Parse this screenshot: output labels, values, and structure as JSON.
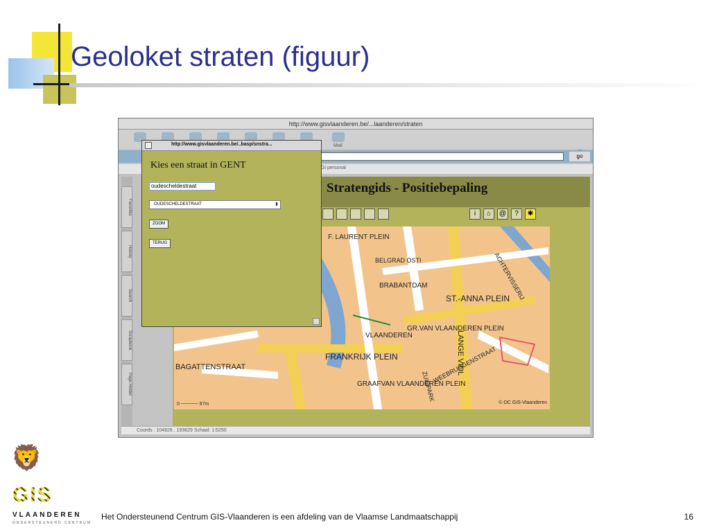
{
  "slide": {
    "title": "Geoloket straten (figuur)",
    "footer": "Het Ondersteunend Centrum GIS-Vlaanderen is een afdeling van de Vlaamse Landmaatschappij",
    "page_number": "16",
    "logo_text": "GIS",
    "logo_name": "VLAANDEREN",
    "logo_subtitle": "ONDERSTEUNEND CENTRUM"
  },
  "browser": {
    "url": "http://www.gisvlaanderen.be/...laanderen/straten",
    "mail_label": "Mail",
    "go_label": "go",
    "favorites_text": "Gi personal",
    "sidebar_tabs": [
      "Favorites",
      "History",
      "Search",
      "Scrapbook",
      "Page Holder"
    ],
    "status": "Coords : 104826 , 193629 Schaal: 1:5250"
  },
  "page": {
    "heading": "Stratengids - Positiebepaling",
    "map_copyright": "© OC GIS-Vlaanderen",
    "scale_start": "0",
    "scale_end": "97m",
    "street_labels": [
      "F. LAURENT PLEIN",
      "BELGRAD OSTI",
      "BRABANTDAM",
      "ST.-ANNA PLEIN",
      "VLAANDEREN",
      "FRANKRIJK PLEIN",
      "GR.VAN VLAANDEREN PLEIN",
      "GRAAFVAN VLAANDEREN PLEIN",
      "BAGATTENSTRAAT",
      "WEEBRUGGENSTRAAT",
      "LANGE VIOL",
      "ZUIDPARK",
      "ACHTERVISSERIJ"
    ]
  },
  "popup": {
    "url": "http://www.gisvlaanderen.be/..basp/snstra...",
    "heading": "Kies een straat in GENT",
    "input_value": "oudescheldestraat",
    "select_value": "OUDESCHELDESTRAAT",
    "zoom_label": "ZOOM",
    "terug_label": "TERUG"
  }
}
